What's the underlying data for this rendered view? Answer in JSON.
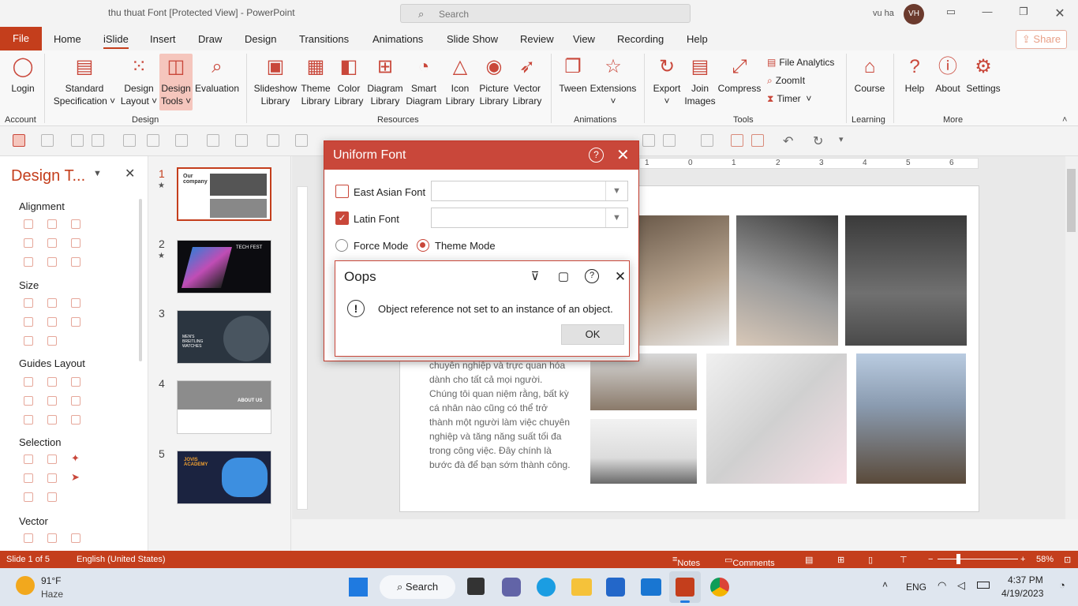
{
  "window": {
    "title": "thu thuat Font [Protected View]  -  PowerPoint",
    "search_placeholder": "Search",
    "user_name": "vu ha",
    "user_initials": "VH"
  },
  "tabs": [
    "Home",
    "iSlide",
    "Insert",
    "Draw",
    "Design",
    "Transitions",
    "Animations",
    "Slide Show",
    "Review",
    "View",
    "Recording",
    "Help"
  ],
  "file_tab": "File",
  "share_label": "Share",
  "ribbon": {
    "login": "Login",
    "standard_spec": [
      "Standard",
      "Specification"
    ],
    "design_layout": [
      "Design",
      "Layout"
    ],
    "design_tools": [
      "Design",
      "Tools"
    ],
    "evaluation": "Evaluation",
    "slideshow_lib": [
      "Slideshow",
      "Library"
    ],
    "theme_lib": [
      "Theme",
      "Library"
    ],
    "color_lib": [
      "Color",
      "Library"
    ],
    "diagram_lib": [
      "Diagram",
      "Library"
    ],
    "smart_diagram": [
      "Smart",
      "Diagram"
    ],
    "icon_lib": [
      "Icon",
      "Library"
    ],
    "picture_lib": [
      "Picture",
      "Library"
    ],
    "vector_lib": [
      "Vector",
      "Library"
    ],
    "tween": "Tween",
    "extensions": "Extensions",
    "export": "Export",
    "join_images": [
      "Join",
      "Images"
    ],
    "compress": "Compress",
    "file_analytics": "File Analytics",
    "zoomit": "ZoomIt",
    "timer": "Timer",
    "course": "Course",
    "help": "Help",
    "about": "About",
    "settings": "Settings",
    "groups": {
      "account": "Account",
      "design": "Design",
      "resources": "Resources",
      "animations": "Animations",
      "tools": "Tools",
      "learning": "Learning",
      "more": "More"
    }
  },
  "pane": {
    "title": "Design T...",
    "sections": [
      "Alignment",
      "Size",
      "Guides Layout",
      "Selection",
      "Vector"
    ]
  },
  "thumbnails": [
    {
      "num": "1",
      "star": "★",
      "label": "Our company"
    },
    {
      "num": "2",
      "star": "★",
      "label": "TECH FEST"
    },
    {
      "num": "3",
      "star": "",
      "label": "MEN'S BREITLING WATCHES"
    },
    {
      "num": "4",
      "star": "",
      "label": "ABOUT US"
    },
    {
      "num": "5",
      "star": "",
      "label": "JOVIS ACADEMY"
    }
  ],
  "ruler_labels": [
    "1",
    "0",
    "1",
    "2",
    "3",
    "4",
    "5",
    "6"
  ],
  "slide": {
    "body_text": "chuyên nghiệp và trực quan hóa dành cho tất cả mọi người. Chúng tôi quan niệm rằng, bất kỳ cá nhân nào cũng có thể trở thành một người làm việc chuyên nghiệp và tăng năng suất tối đa trong công việc. Đây chính là bước đà để bạn sớm thành công."
  },
  "uniform_font": {
    "title": "Uniform Font",
    "east_asian_label": "East Asian Font",
    "east_asian_checked": false,
    "latin_label": "Latin Font",
    "latin_checked": true,
    "force_mode": "Force Mode",
    "theme_mode": "Theme Mode",
    "selected_mode": "Theme Mode"
  },
  "oops": {
    "title": "Oops",
    "message": "Object reference not set to an instance of an object.",
    "ok": "OK"
  },
  "status": {
    "slide": "Slide 1 of 5",
    "language": "English (United States)",
    "notes": "Notes",
    "comments": "Comments",
    "zoom": "58%"
  },
  "taskbar": {
    "temp": "91°F",
    "weather": "Haze",
    "search": "Search",
    "lang": "ENG",
    "time": "4:37 PM",
    "date": "4/19/2023"
  },
  "colors": {
    "accent": "#c43e1c",
    "dialog": "#c9473a"
  }
}
